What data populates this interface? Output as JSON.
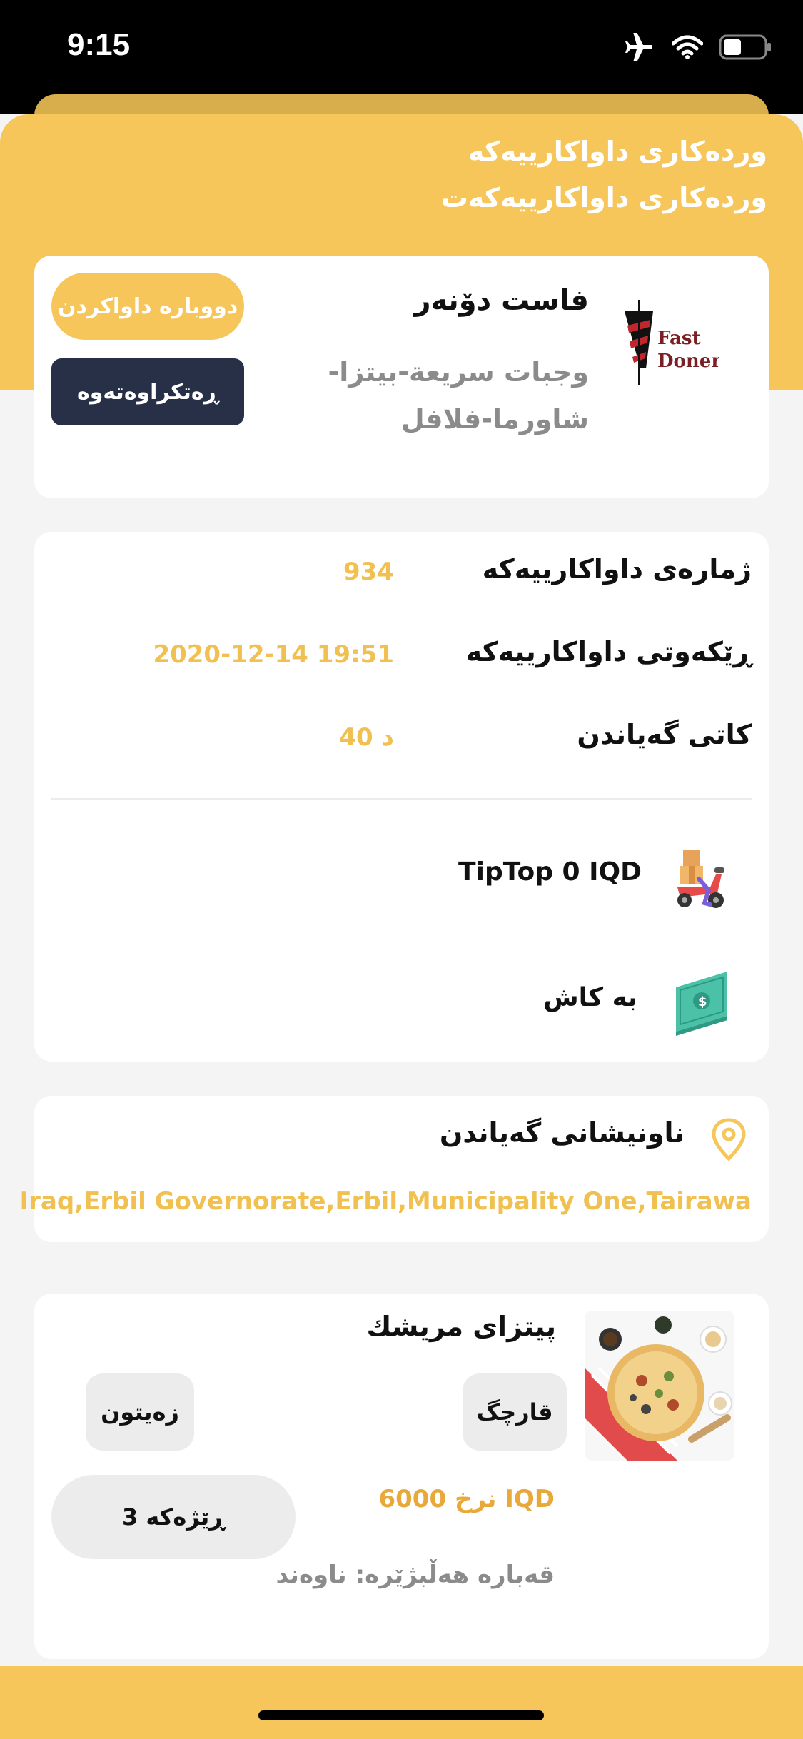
{
  "status_bar": {
    "time": "9:15"
  },
  "header": {
    "title_1": "وردەکاری داواکارییەکە",
    "title_2": "وردەکاری داواکارییەکەت"
  },
  "restaurant": {
    "name": "فاست دۆنەر",
    "categories": "وجبات سريعة-بيتزا-شاورما-فلافل",
    "logo_text_1": "Fast",
    "logo_text_2": "Doner",
    "reorder_label": "دووبارە داواکردن",
    "status_label": "ڕەتکراوەتەوە"
  },
  "order_info": {
    "number_label": "ژمارەی داواکارییەکە",
    "number_value": "934",
    "date_label": "ڕێکەوتی داواکارییەکە",
    "date_value": "2020-12-14 19:51",
    "time_label": "کاتی گەیاندن",
    "time_value": "40  د",
    "delivery_company": "TipTop 0 IQD",
    "payment_method": "بە کاش"
  },
  "address": {
    "title": "ناونیشانی گەیاندن",
    "value": "Iraq,Erbil Governorate,Erbil,Municipality One,Tairawa"
  },
  "item": {
    "name": "پیتزای مریشك",
    "addon_1": "قارچگ",
    "addon_2": "زەیتون",
    "price": "نرخ 6000 IQD",
    "quantity": "ڕێژەکە 3",
    "size": "قەبارە هەڵبژێرە: ناوەند"
  },
  "colors": {
    "accent": "#f6c65b",
    "dark_button": "#283048",
    "value_text": "#f0c050",
    "price_text": "#e8a93a"
  }
}
